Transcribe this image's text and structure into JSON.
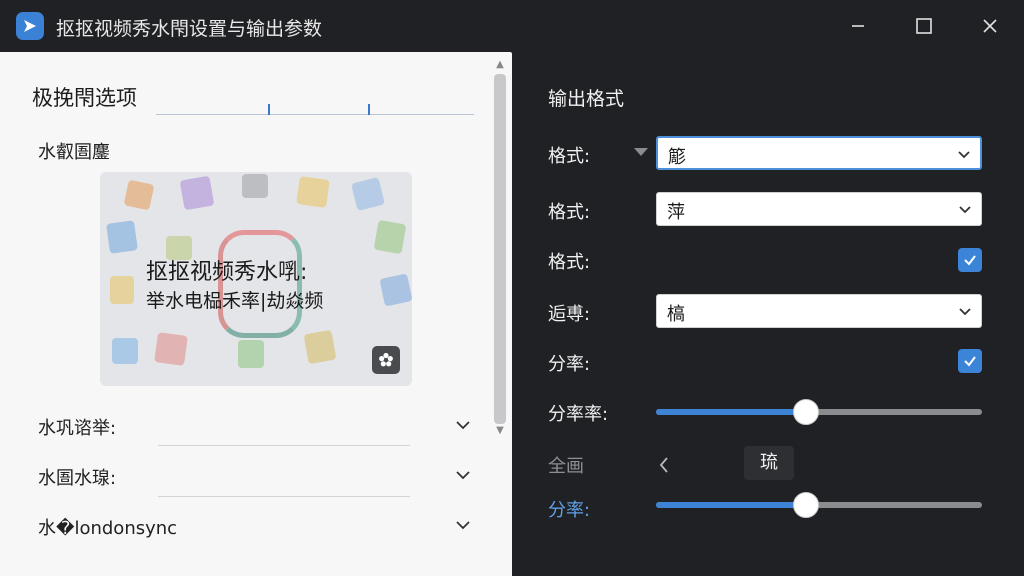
{
  "window": {
    "title": "抠抠视频秀水閇设置与输出参数"
  },
  "left_panel": {
    "section_title": "极挽閇选项",
    "sub_label": "水叡圄鏖",
    "preview": {
      "line1": "抠抠视频秀水啂:",
      "line2": "举水电榀禾率|劫焱频"
    },
    "collapsibles": [
      {
        "label": "水巩谘举:"
      },
      {
        "label": "水圄水瑔:"
      },
      {
        "label": "水�londonsync"
      }
    ]
  },
  "right_panel": {
    "title": "输出格式",
    "rows": [
      {
        "label": "格式:",
        "value": "簓"
      },
      {
        "label": "格式:",
        "value": "萍"
      },
      {
        "label": "格式:"
      },
      {
        "label": "逅尃:",
        "value": "槁"
      },
      {
        "label": "分率:"
      },
      {
        "label": "分率率:"
      },
      {
        "label": "全画",
        "tooltip": "琉"
      },
      {
        "label": "分率:"
      }
    ],
    "checkboxes": {
      "row3_checked": true,
      "row5_checked": true
    },
    "sliders": {
      "slider1_value": 0.46,
      "slider2_value": 0.46
    }
  },
  "colors": {
    "accent": "#3b84d8",
    "panel_dark": "#202124",
    "panel_light": "#f7f7f8"
  }
}
